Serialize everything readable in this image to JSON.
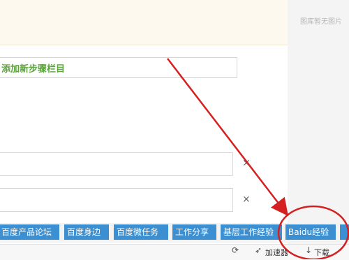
{
  "sidebar": {
    "text": "图库暂无图片"
  },
  "editor": {
    "add_step_label": "添加新步骤栏目",
    "close_symbol": "×"
  },
  "tags": [
    "百度产品论坛",
    "百度身边",
    "百度微任务",
    "工作分享",
    "基层工作经验",
    "Baidu经验"
  ],
  "statusbar": {
    "accelerator_label": "加速器",
    "download_label": "下载"
  },
  "annotation": {
    "color": "#d42020"
  }
}
